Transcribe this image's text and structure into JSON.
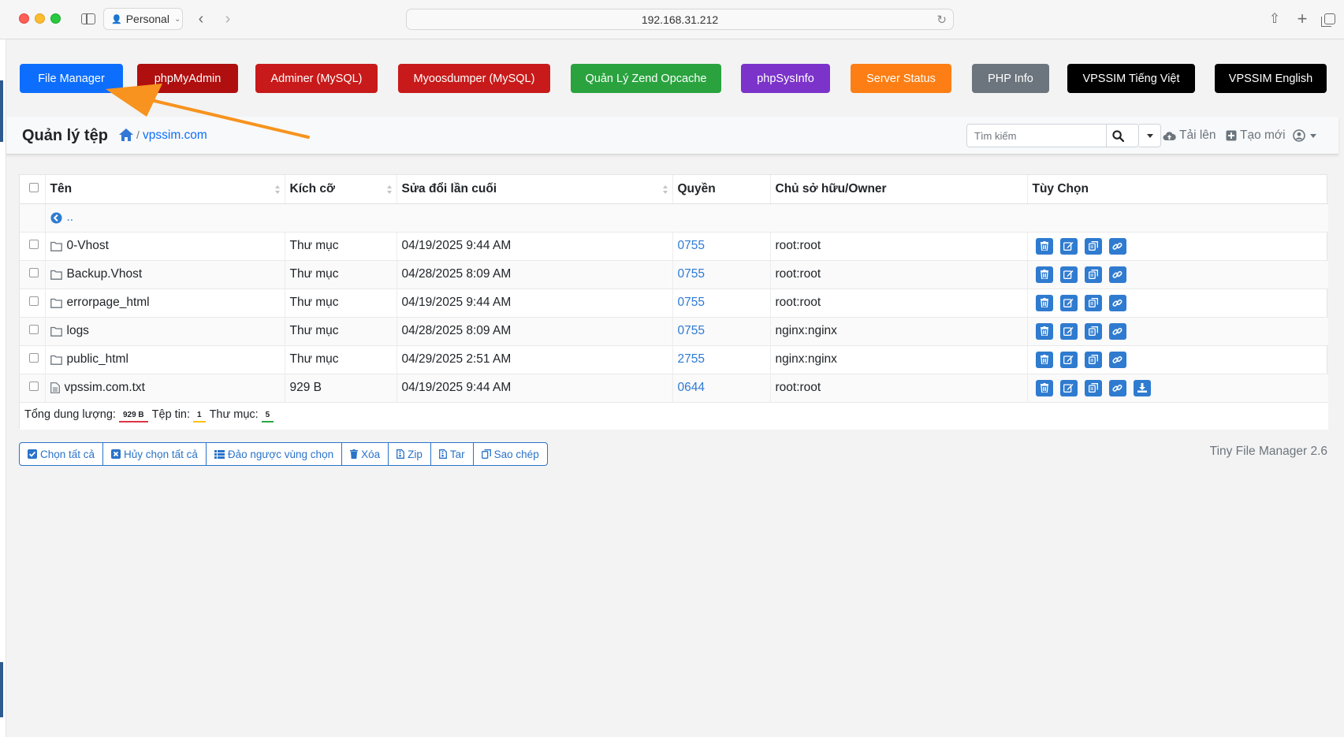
{
  "browser": {
    "profile": "Personal",
    "url": "192.168.31.212"
  },
  "tools": [
    {
      "label": "File Manager",
      "color": "#0d6efd"
    },
    {
      "label": "phpMyAdmin",
      "color": "#b00f0f"
    },
    {
      "label": "Adminer (MySQL)",
      "color": "#c81a1a"
    },
    {
      "label": "Myoosdumper (MySQL)",
      "color": "#c81a1a"
    },
    {
      "label": "Quản Lý Zend Opcache",
      "color": "#2aa33f"
    },
    {
      "label": "phpSysInfo",
      "color": "#7b33c9"
    },
    {
      "label": "Server Status",
      "color": "#fd7e14"
    },
    {
      "label": "PHP Info",
      "color": "#6c757d"
    },
    {
      "label": "VPSSIM Tiếng Việt",
      "color": "#000000"
    },
    {
      "label": "VPSSIM English",
      "color": "#000000"
    }
  ],
  "header": {
    "title": "Quản lý tệp",
    "breadcrumb_sep": "/",
    "breadcrumb": "vpssim.com",
    "search_placeholder": "Tìm kiếm",
    "upload": "Tải lên",
    "create": "Tạo mới"
  },
  "table": {
    "columns": [
      "Tên",
      "Kích cỡ",
      "Sửa đổi lần cuối",
      "Quyền",
      "Chủ sở hữu/Owner",
      "Tùy Chọn"
    ],
    "parent": "..",
    "rows": [
      {
        "name": "0-Vhost",
        "type": "folder",
        "size": "Thư mục",
        "modified": "04/19/2025 9:44 AM",
        "perm": "0755",
        "owner": "root:root"
      },
      {
        "name": "Backup.Vhost",
        "type": "folder",
        "size": "Thư mục",
        "modified": "04/28/2025 8:09 AM",
        "perm": "0755",
        "owner": "root:root"
      },
      {
        "name": "errorpage_html",
        "type": "folder",
        "size": "Thư mục",
        "modified": "04/19/2025 9:44 AM",
        "perm": "0755",
        "owner": "root:root"
      },
      {
        "name": "logs",
        "type": "folder",
        "size": "Thư mục",
        "modified": "04/28/2025 8:09 AM",
        "perm": "0755",
        "owner": "nginx:nginx"
      },
      {
        "name": "public_html",
        "type": "folder",
        "size": "Thư mục",
        "modified": "04/29/2025 2:51 AM",
        "perm": "2755",
        "owner": "nginx:nginx"
      },
      {
        "name": "vpssim.com.txt",
        "type": "file",
        "size": "929 B",
        "modified": "04/19/2025 9:44 AM",
        "perm": "0644",
        "owner": "root:root"
      }
    ]
  },
  "summary": {
    "total_label": "Tổng dung lượng:",
    "total_value": "929 B",
    "files_label": "Tệp tin:",
    "files_value": "1",
    "folders_label": "Thư mục:",
    "folders_value": "5"
  },
  "actions": [
    "Chọn tất cả",
    "Hủy chọn tất cả",
    "Đảo ngược vùng chọn",
    "Xóa",
    "Zip",
    "Tar",
    "Sao chép"
  ],
  "footer": "Tiny File Manager 2.6",
  "colors": {
    "link": "#0d6efd",
    "action_icon_bg": "#2f7bd0",
    "annotation_arrow": "#f7931e"
  }
}
